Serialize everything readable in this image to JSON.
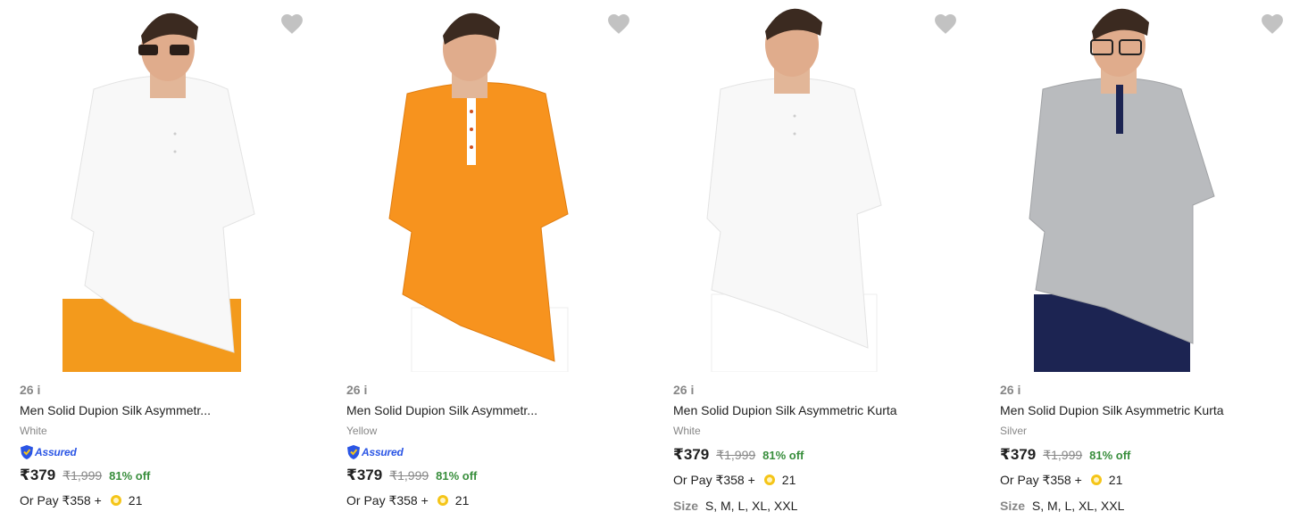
{
  "products": [
    {
      "brand": "26 i",
      "title": "Men Solid Dupion Silk Asymmetr...",
      "color": "White",
      "assured": true,
      "assured_label": "Assured",
      "price": "₹379",
      "mrp": "₹1,999",
      "discount": "81% off",
      "or_pay": "Or Pay ₹358 +",
      "coins": "21",
      "kurta_color": "#f7f7f7",
      "bottom_color": "#f39a1c"
    },
    {
      "brand": "26 i",
      "title": "Men Solid Dupion Silk Asymmetr...",
      "color": "Yellow",
      "assured": true,
      "assured_label": "Assured",
      "price": "₹379",
      "mrp": "₹1,999",
      "discount": "81% off",
      "or_pay": "Or Pay ₹358 +",
      "coins": "21",
      "kurta_color": "#f7931e",
      "bottom_color": "#ffffff"
    },
    {
      "brand": "26 i",
      "title": "Men Solid Dupion Silk Asymmetric Kurta",
      "color": "White",
      "assured": false,
      "price": "₹379",
      "mrp": "₹1,999",
      "discount": "81% off",
      "or_pay": "Or Pay ₹358 +",
      "coins": "21",
      "size_label": "Size",
      "sizes": "S, M, L, XL, XXL",
      "kurta_color": "#f8f8f8",
      "bottom_color": "#ffffff"
    },
    {
      "brand": "26 i",
      "title": "Men Solid Dupion Silk Asymmetric Kurta",
      "color": "Silver",
      "assured": false,
      "price": "₹379",
      "mrp": "₹1,999",
      "discount": "81% off",
      "or_pay": "Or Pay ₹358 +",
      "coins": "21",
      "size_label": "Size",
      "sizes": "S, M, L, XL, XXL",
      "kurta_color": "#b9bbbe",
      "bottom_color": "#1c2452"
    }
  ],
  "icons": {
    "wishlist": "heart-icon",
    "assured_badge": "shield-icon",
    "coin": "coin-icon"
  },
  "colors": {
    "discount": "#388e3c",
    "assured": "#2a55e5",
    "muted": "#878787",
    "heart": "#c2c2c2"
  }
}
